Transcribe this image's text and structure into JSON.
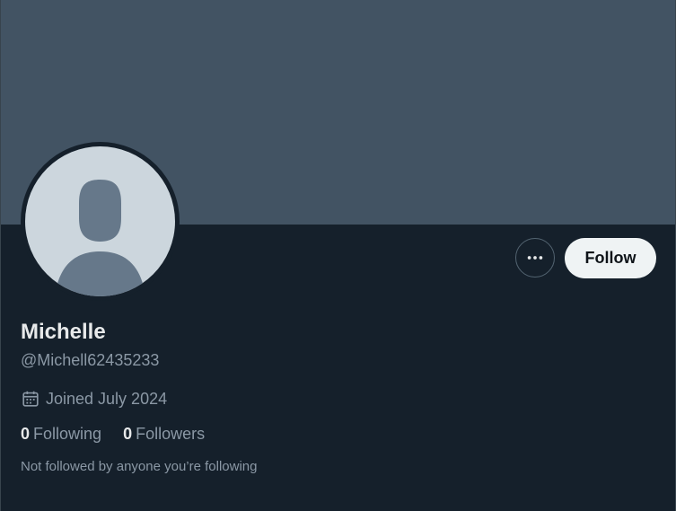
{
  "profile": {
    "display_name": "Michelle",
    "handle": "@Michell62435233",
    "joined_text": "Joined July 2024",
    "following_count": "0",
    "following_label": "Following",
    "followers_count": "0",
    "followers_label": "Followers",
    "not_followed_text": "Not followed by anyone you’re following"
  },
  "actions": {
    "more_icon": "more-horizontal-icon",
    "follow_label": "Follow"
  },
  "icons": {
    "calendar": "calendar-icon",
    "avatar": "default-avatar-icon"
  },
  "colors": {
    "background": "#15202b",
    "banner": "#425363",
    "primary_text": "#e7e9ea",
    "secondary_text": "#8b98a5",
    "follow_button_bg": "#eff3f4",
    "follow_button_text": "#0f1419",
    "avatar_bg": "#ccd6dd",
    "avatar_figure": "#66788a"
  }
}
